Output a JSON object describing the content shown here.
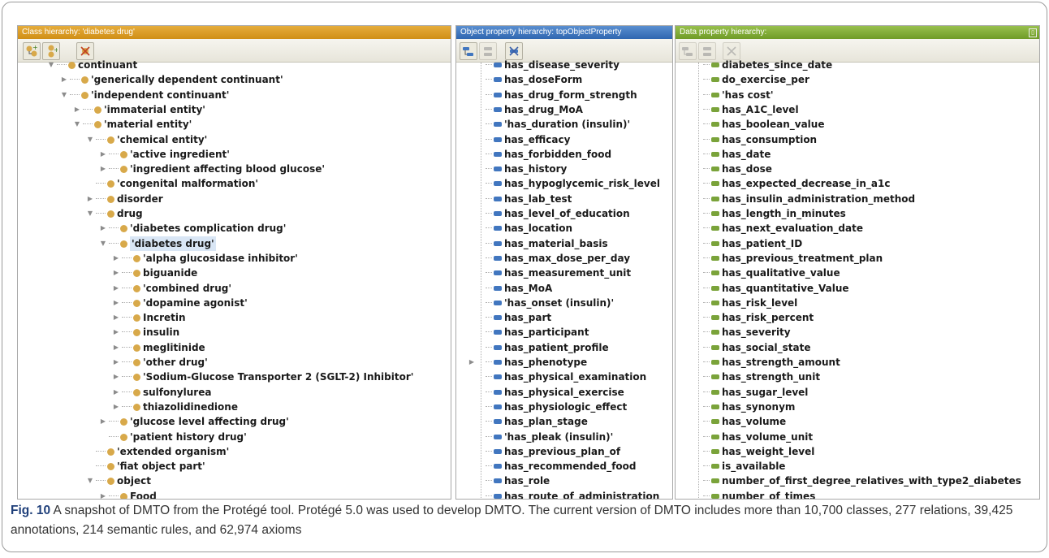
{
  "class_panel": {
    "title": "Class hierarchy: 'diabetes drug'",
    "icons": [
      "add-subclass-icon",
      "add-sibling-icon",
      "delete-class-icon"
    ],
    "rows": [
      {
        "label": "continuant",
        "expanded": true
      },
      {
        "label": "'generically dependent continuant'",
        "expanded": false
      },
      {
        "label": "'independent continuant'",
        "expanded": true
      },
      {
        "label": "'immaterial entity'",
        "expanded": false
      },
      {
        "label": "'material entity'",
        "expanded": true
      },
      {
        "label": "'chemical entity'",
        "expanded": true
      },
      {
        "label": "'active ingredient'",
        "expanded": false
      },
      {
        "label": "'ingredient affecting blood glucose'",
        "expanded": false
      },
      {
        "label": "'congenital malformation'"
      },
      {
        "label": "disorder",
        "expanded": false
      },
      {
        "label": "drug",
        "expanded": true
      },
      {
        "label": "'diabetes complication drug'",
        "expanded": false
      },
      {
        "label": "'diabetes drug'",
        "expanded": true,
        "selected": true
      },
      {
        "label": "'alpha glucosidase inhibitor'",
        "expanded": false
      },
      {
        "label": "biguanide",
        "expanded": false
      },
      {
        "label": "'combined drug'",
        "expanded": false
      },
      {
        "label": "'dopamine agonist'",
        "expanded": false
      },
      {
        "label": "Incretin",
        "expanded": false
      },
      {
        "label": "insulin",
        "expanded": false
      },
      {
        "label": "meglitinide",
        "expanded": false
      },
      {
        "label": "'other drug'",
        "expanded": false
      },
      {
        "label": "'Sodium-Glucose Transporter 2 (SGLT-2) Inhibitor'",
        "expanded": false
      },
      {
        "label": "sulfonylurea",
        "expanded": false
      },
      {
        "label": "thiazolidinedione",
        "expanded": false
      },
      {
        "label": "'glucose level affecting drug'",
        "expanded": false
      },
      {
        "label": "'patient history drug'"
      },
      {
        "label": "'extended organism'"
      },
      {
        "label": "'fiat object part'"
      },
      {
        "label": "object",
        "expanded": true
      },
      {
        "label": "Food",
        "expanded": false
      }
    ]
  },
  "object_panel": {
    "title": "Object property hierarchy: topObjectProperty",
    "icons": [
      "add-sub-property-icon",
      "add-sibling-property-icon",
      "delete-property-icon"
    ],
    "rows": [
      "has_disease_severity",
      "has_doseForm",
      "has_drug_form_strength",
      "has_drug_MoA",
      "'has_duration (insulin)'",
      "has_efficacy",
      "has_forbidden_food",
      "has_history",
      "has_hypoglycemic_risk_level",
      "has_lab_test",
      "has_level_of_education",
      "has_location",
      "has_material_basis",
      "has_max_dose_per_day",
      "has_measurement_unit",
      "has_MoA",
      "'has_onset (insulin)'",
      "has_part",
      "has_participant",
      "has_patient_profile",
      "has_phenotype",
      "has_physical_examination",
      "has_physical_exercise",
      "has_physiologic_effect",
      "has_plan_stage",
      "'has_pleak (insulin)'",
      "has_previous_plan_of",
      "has_recommended_food",
      "has_role",
      "has_route_of_administration"
    ],
    "expandable_row": 20
  },
  "data_panel": {
    "title": "Data property hierarchy:",
    "close_glyph": "▯",
    "icons": [
      "add-sub-property-icon",
      "add-sibling-property-icon",
      "delete-property-icon"
    ],
    "rows": [
      "diabetes_since_date",
      "do_exercise_per",
      "'has cost'",
      "has_A1C_level",
      "has_boolean_value",
      "has_consumption",
      "has_date",
      "has_dose",
      "has_expected_decrease_in_a1c",
      "has_insulin_administration_method",
      "has_length_in_minutes",
      "has_next_evaluation_date",
      "has_patient_ID",
      "has_previous_treatment_plan",
      "has_qualitative_value",
      "has_quantitative_Value",
      "has_risk_level",
      "has_risk_percent",
      "has_severity",
      "has_social_state",
      "has_strength_amount",
      "has_strength_unit",
      "has_sugar_level",
      "has_synonym",
      "has_volume",
      "has_volume_unit",
      "has_weight_level",
      "is_available",
      "number_of_first_degree_relatives_with_type2_diabetes",
      "number_of_times"
    ]
  },
  "caption": {
    "fig": "Fig. 10",
    "text": " A snapshot of DMTO from the Protégé tool. Protégé 5.0 was used to develop DMTO. The current version of DMTO includes more than 10,700 classes, 277 relations, 39,425 annotations, 214 semantic rules, and 62,974 axioms"
  }
}
